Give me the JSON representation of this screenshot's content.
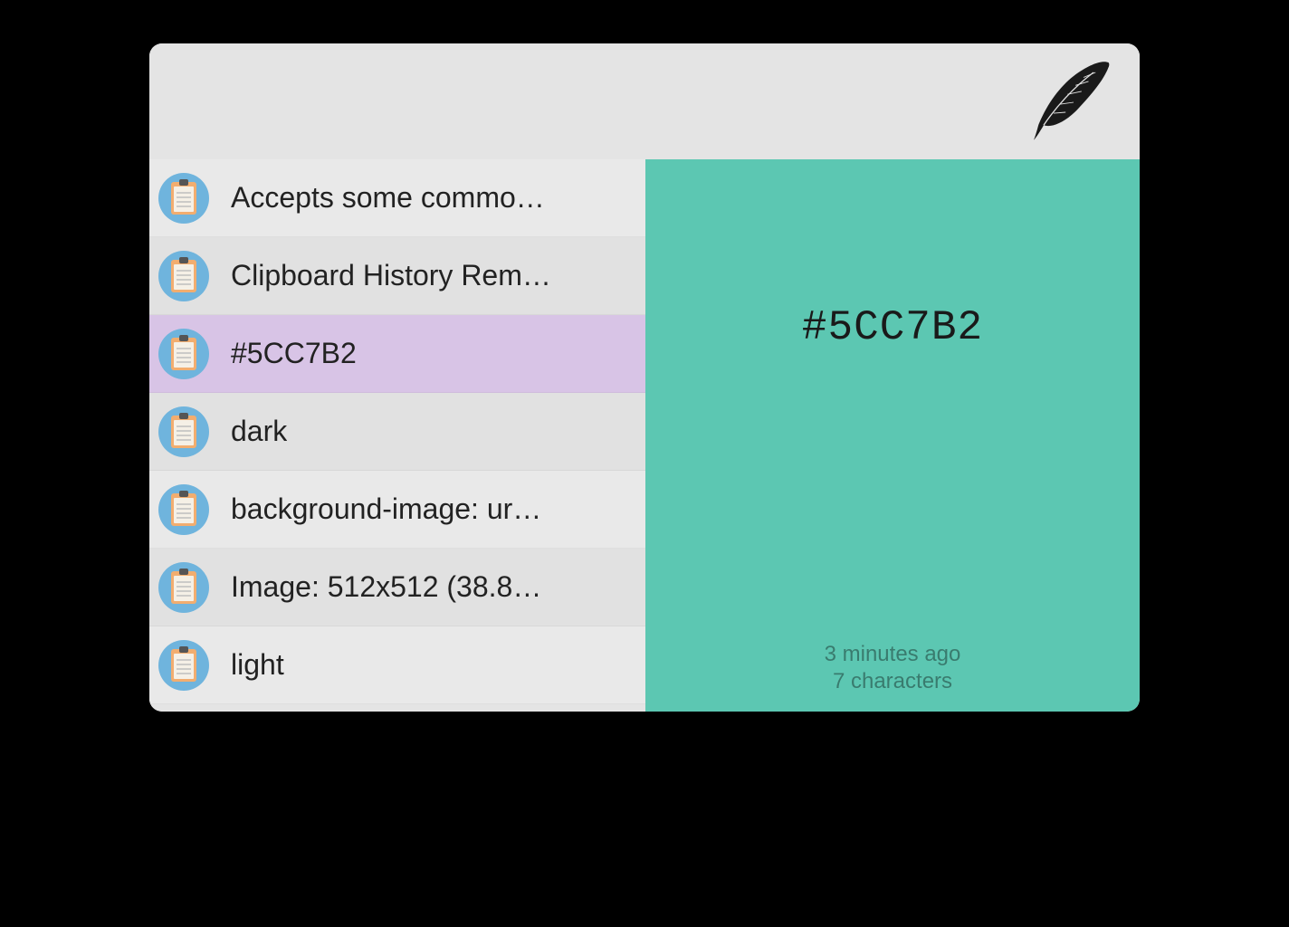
{
  "items": [
    {
      "label": "Accepts some commo…",
      "selected": false
    },
    {
      "label": "Clipboard History Rem…",
      "selected": false
    },
    {
      "label": "#5CC7B2",
      "selected": true
    },
    {
      "label": "dark",
      "selected": false
    },
    {
      "label": "background-image: ur…",
      "selected": false
    },
    {
      "label": "Image: 512x512 (38.8…",
      "selected": false
    },
    {
      "label": "light",
      "selected": false
    }
  ],
  "preview": {
    "background_color": "#5CC7B2",
    "text": "#5CC7B2",
    "time_ago": "3 minutes ago",
    "char_count": "7 characters"
  }
}
